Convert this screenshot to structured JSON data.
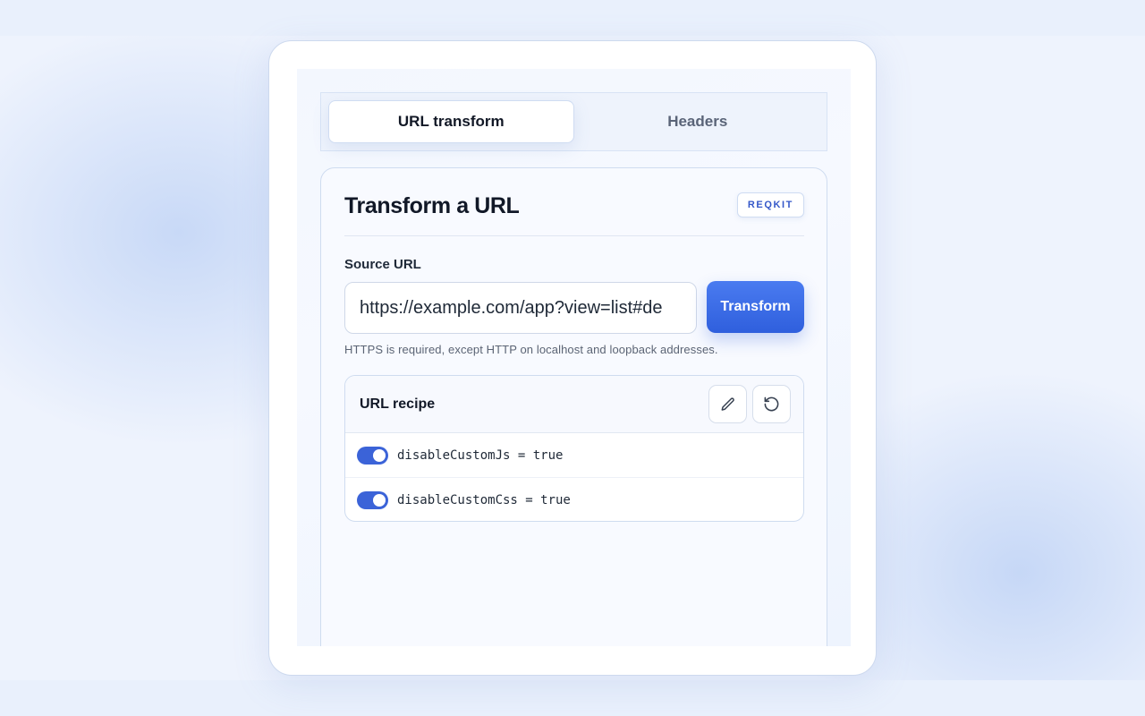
{
  "tabs": [
    {
      "label": "URL transform",
      "active": true
    },
    {
      "label": "Headers",
      "active": false
    }
  ],
  "card": {
    "title": "Transform a URL",
    "badge": "REQKIT"
  },
  "source": {
    "label": "Source URL",
    "value": "https://example.com/app?view=list#de",
    "transform_label": "Transform",
    "helper": "HTTPS is required, except HTTP on localhost and loopback addresses."
  },
  "recipe": {
    "title": "URL recipe",
    "edit_icon": "pencil-icon",
    "reset_icon": "reset-icon",
    "rules": [
      {
        "key": "disableCustomJs",
        "operator": "=",
        "value": "true",
        "enabled": true,
        "text": "disableCustomJs = true"
      },
      {
        "key": "disableCustomCss",
        "operator": "=",
        "value": "true",
        "enabled": true,
        "text": "disableCustomCss = true"
      }
    ]
  },
  "colors": {
    "accent": "#3b63d8",
    "button": "#2f5fdd",
    "badge_text": "#3558c9"
  }
}
